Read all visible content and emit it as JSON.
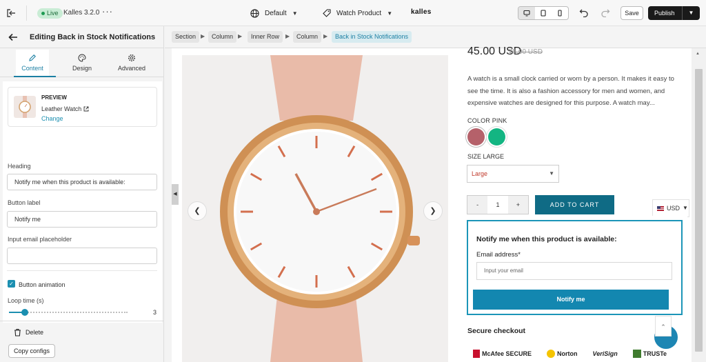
{
  "topbar": {
    "live_badge": "Live",
    "app_name": "Kalles 3.2.0",
    "more_label": "···",
    "language_value": "Default",
    "template_value": "Watch Product",
    "brand": "kalles",
    "save_label": "Save",
    "publish_label": "Publish"
  },
  "sidebar": {
    "title": "Editing Back in Stock Notifications",
    "tabs": [
      {
        "label": "Content",
        "icon": "pencil-icon",
        "active": true
      },
      {
        "label": "Design",
        "icon": "palette-icon",
        "active": false
      },
      {
        "label": "Advanced",
        "icon": "gear-icon",
        "active": false
      }
    ],
    "preview": {
      "label": "PREVIEW",
      "product": "Leather Watch",
      "change_label": "Change"
    },
    "fields": {
      "heading_label": "Heading",
      "heading_value": "Notify me when this product is available:",
      "button_label_label": "Button label",
      "button_label_value": "Notify me",
      "placeholder_label": "Input email placeholder",
      "placeholder_value": ""
    },
    "button_animation_label": "Button animation",
    "button_animation_checked": true,
    "loop_time_label": "Loop time (s)",
    "loop_time_value": "3",
    "loop_time_fraction": 0.12,
    "delete_label": "Delete",
    "copy_configs_label": "Copy configs"
  },
  "breadcrumbs": [
    "Section",
    "Column",
    "Inner Row",
    "Column",
    "Back in Stock Notifications"
  ],
  "product": {
    "price": "45.00 USD",
    "old_price": "75.00 USD",
    "description": "A watch is a small clock carried or worn by a person. It makes it easy to see the time. It is also a fashion accessory for men and women, and expensive watches are designed for this purpose. A watch may...",
    "color_label": "COLOR PINK",
    "swatches": [
      {
        "name": "pink",
        "color": "#b5616a"
      },
      {
        "name": "green",
        "color": "#13b582"
      }
    ],
    "size_label": "SIZE LARGE",
    "size_value": "Large",
    "qty_minus": "-",
    "qty_value": "1",
    "qty_plus": "+",
    "add_to_cart": "ADD TO CART",
    "currency": "USD"
  },
  "notify": {
    "heading": "Notify me when this product is available:",
    "email_label": "Email address*",
    "email_placeholder": "Input your email",
    "button_label": "Notify me"
  },
  "checkout": {
    "title": "Secure checkout",
    "badges": [
      "McAfee SECURE",
      "Norton",
      "VeriSign",
      "TRUSTe"
    ]
  },
  "colors": {
    "accent": "#1b8fb0",
    "add_to_cart_bg": "#0f6b85",
    "notify_button_bg": "#1387b0",
    "live_green": "#1e9a52"
  }
}
